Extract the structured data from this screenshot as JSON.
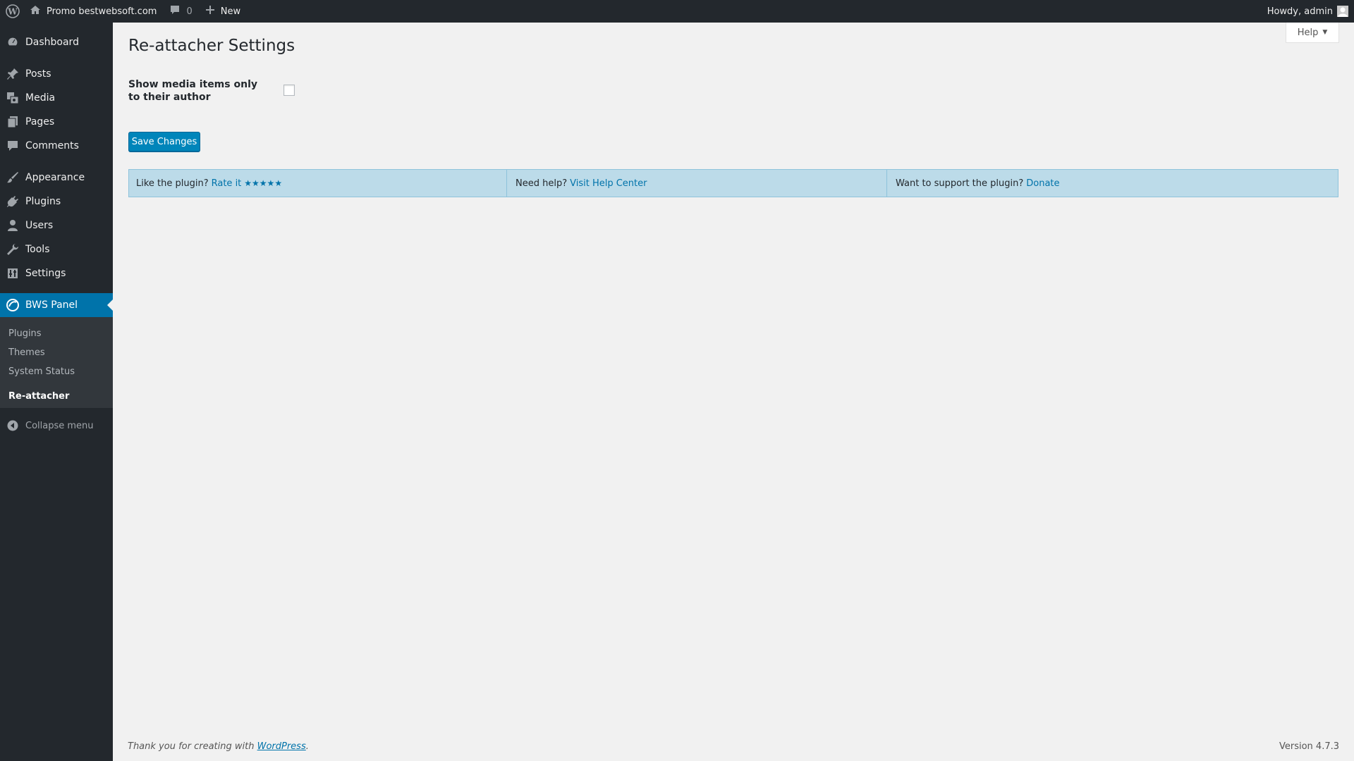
{
  "adminbar": {
    "site_name": "Promo bestwebsoft.com",
    "comments_count": "0",
    "new_label": "New",
    "greeting": "Howdy, admin"
  },
  "sidebar": {
    "items": [
      {
        "label": "Dashboard",
        "icon": "dashboard-icon"
      },
      {
        "label": "Posts",
        "icon": "pin-icon"
      },
      {
        "label": "Media",
        "icon": "media-icon"
      },
      {
        "label": "Pages",
        "icon": "pages-icon"
      },
      {
        "label": "Comments",
        "icon": "comment-icon"
      },
      {
        "label": "Appearance",
        "icon": "brush-icon"
      },
      {
        "label": "Plugins",
        "icon": "plug-icon"
      },
      {
        "label": "Users",
        "icon": "user-icon"
      },
      {
        "label": "Tools",
        "icon": "wrench-icon"
      },
      {
        "label": "Settings",
        "icon": "settings-icon"
      },
      {
        "label": "BWS Panel",
        "icon": "bws-icon"
      }
    ],
    "submenu": [
      "Plugins",
      "Themes",
      "System Status"
    ],
    "current_plugin": "Re-attacher",
    "collapse_label": "Collapse menu"
  },
  "help_tab": {
    "label": "Help"
  },
  "page": {
    "title": "Re-attacher Settings",
    "field_label": "Show media items only to their author",
    "checkbox_checked": false,
    "save_label": "Save Changes"
  },
  "info_bar": {
    "rate_text": "Like the plugin?",
    "rate_link": "Rate it",
    "stars": "★★★★★",
    "help_text": "Need help?",
    "help_link": "Visit Help Center",
    "support_text": "Want to support the plugin?",
    "support_link": "Donate"
  },
  "footer": {
    "thanks_prefix": "Thank you for creating with",
    "thanks_link": "WordPress",
    "thanks_suffix": ".",
    "version": "Version 4.7.3"
  },
  "colors": {
    "adminbar_bg": "#23282d",
    "accent": "#0073aa",
    "info_bar_bg": "#bcdbe9"
  }
}
